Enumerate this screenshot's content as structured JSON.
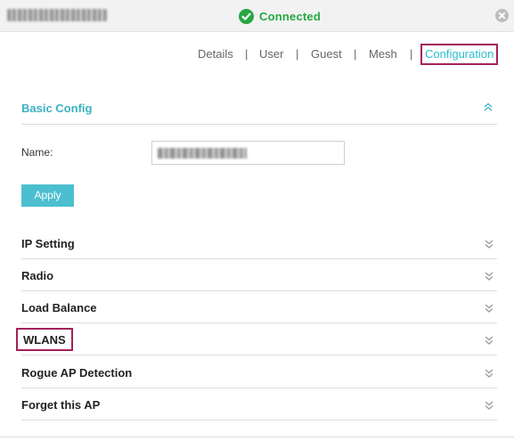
{
  "header": {
    "device_name": "",
    "status_text": "Connected",
    "status_icon": "check-circle-icon",
    "close_icon": "close-icon"
  },
  "tabs": [
    {
      "label": "Details",
      "active": false
    },
    {
      "label": "User",
      "active": false
    },
    {
      "label": "Guest",
      "active": false
    },
    {
      "label": "Mesh",
      "active": false
    },
    {
      "label": "Configuration",
      "active": true
    }
  ],
  "tab_separator": "|",
  "basic_config": {
    "title": "Basic Config",
    "name_label": "Name:",
    "name_value": "",
    "apply_label": "Apply"
  },
  "sections": [
    {
      "label": "IP Setting"
    },
    {
      "label": "Radio"
    },
    {
      "label": "Load Balance"
    },
    {
      "label": "WLANS"
    },
    {
      "label": "Rogue AP Detection"
    },
    {
      "label": "Forget this AP"
    }
  ],
  "colors": {
    "accent": "#3bb2c2",
    "connected": "#26a744",
    "highlight_box": "#a3215a",
    "apply_button": "#4bbfcf"
  }
}
